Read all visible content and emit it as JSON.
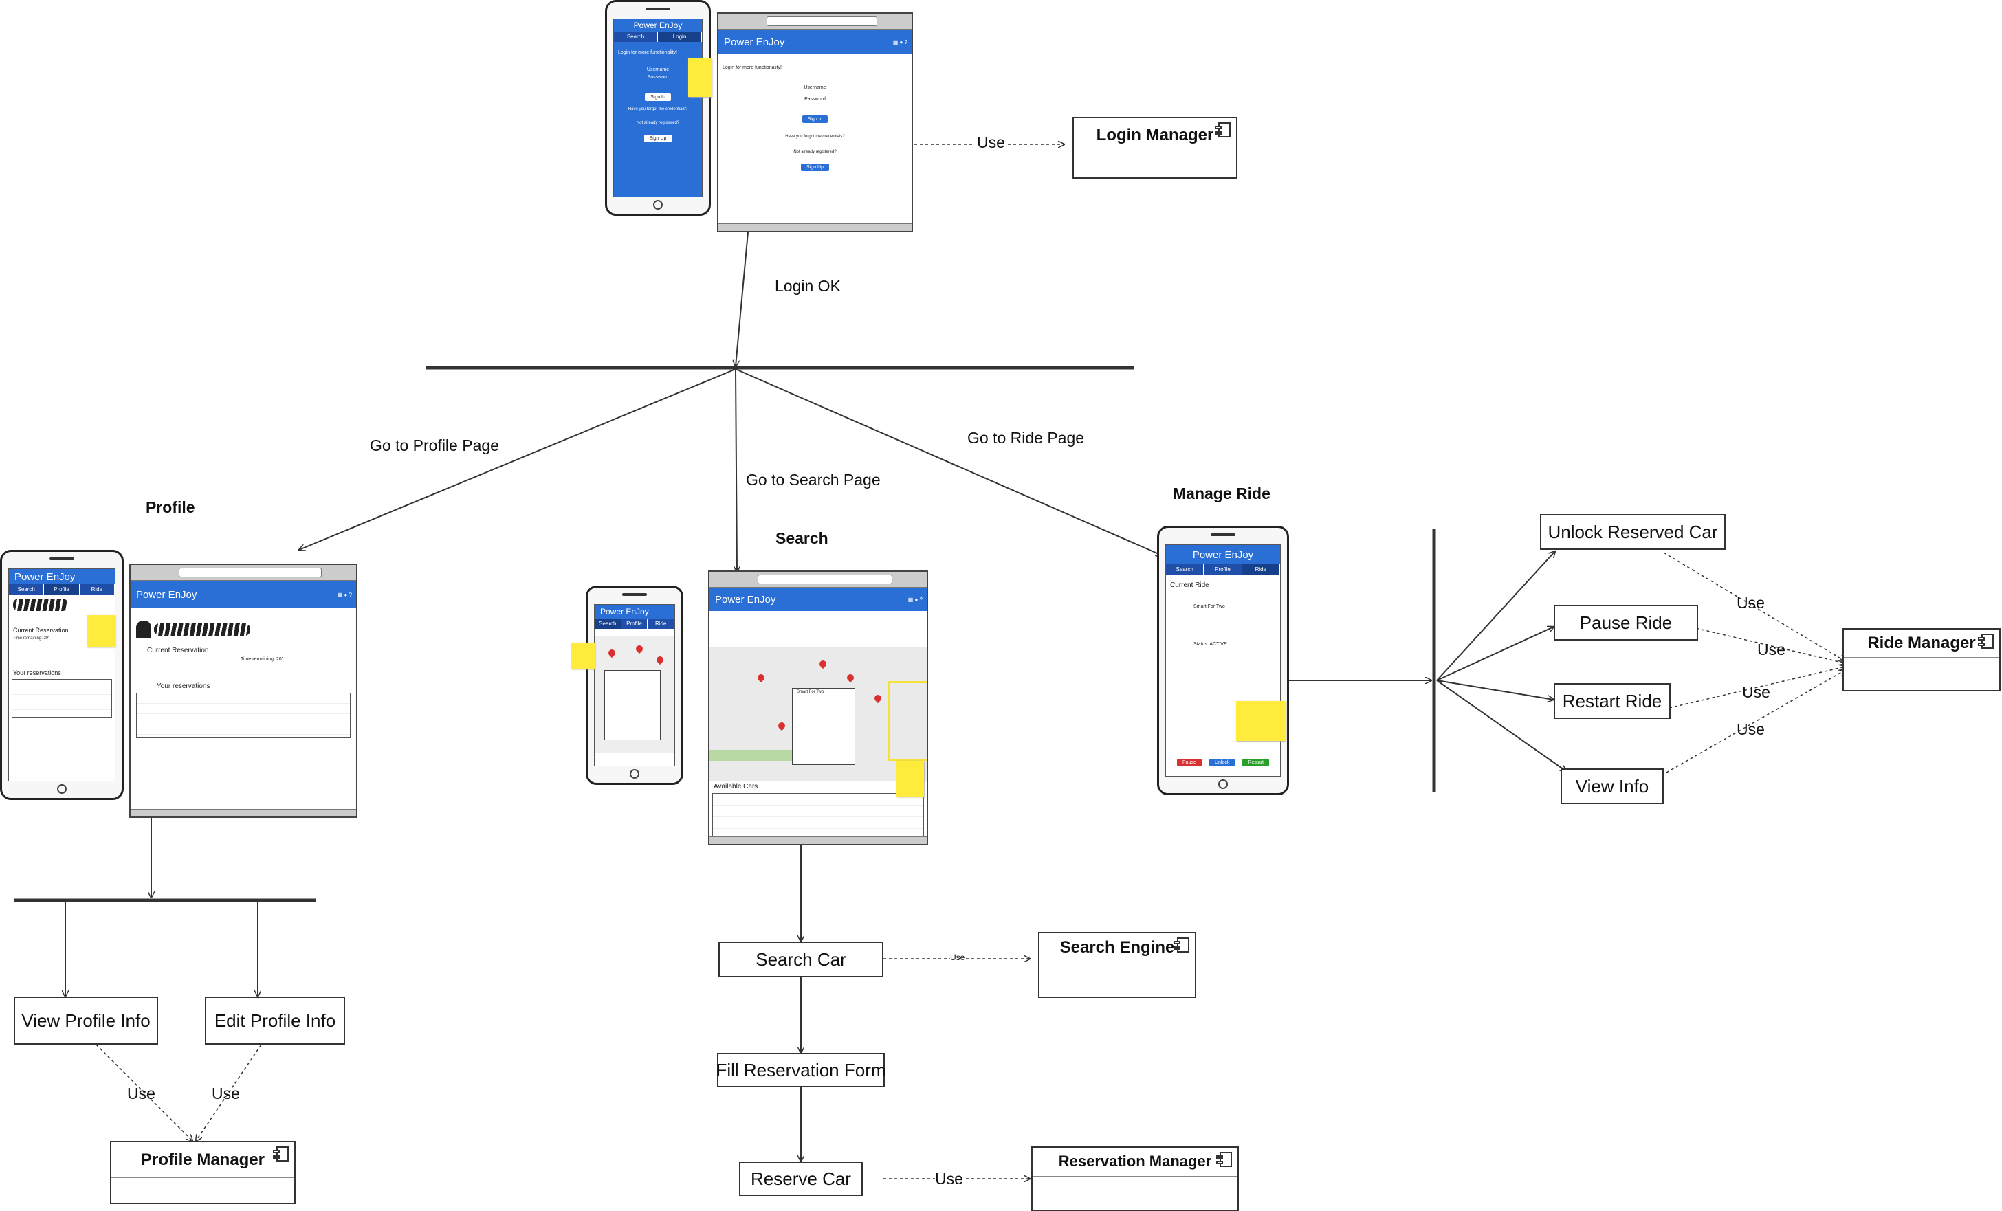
{
  "labels": {
    "login_use": "Use",
    "login_ok": "Login OK",
    "go_profile": "Go to Profile Page",
    "go_search": "Go to Search Page",
    "go_ride": "Go to Ride Page",
    "use_view_profile": "Use",
    "use_edit_profile": "Use",
    "use_search_engine": "Use",
    "use_reservation": "Use",
    "use_unlock": "Use",
    "use_pause": "Use",
    "use_restart": "Use",
    "use_view_info": "Use"
  },
  "titles": {
    "profile": "Profile",
    "search": "Search",
    "manage_ride": "Manage Ride"
  },
  "actions": {
    "view_profile_info": "View Profile Info",
    "edit_profile_info": "Edit Profile Info",
    "search_car": "Search Car",
    "fill_reservation_form": "Fill Reservation Form",
    "reserve_car": "Reserve Car",
    "unlock_reserved_car": "Unlock Reserved Car",
    "pause_ride": "Pause Ride",
    "restart_ride": "Restart Ride",
    "view_info": "View Info"
  },
  "components": {
    "login_manager": "Login Manager",
    "profile_manager": "Profile Manager",
    "search_engine": "Search Engine",
    "reservation_manager": "Reservation Manager",
    "ride_manager": "Ride Manager"
  },
  "mockups": {
    "app_name": "Power EnJoy",
    "tab_search": "Search",
    "tab_profile": "Profile",
    "tab_ride": "Ride",
    "tab_login": "Login",
    "nav_map": "Map",
    "nav_profile": "Profile",
    "nav_help": "Help",
    "login_prompt": "Login for more functionality!",
    "username": "Username",
    "password": "Password",
    "sign_in": "Sign In",
    "forgot": "Have you forgot the credentials?",
    "not_registered": "Not already registered?",
    "sign_up": "Sign Up",
    "current_reservation": "Current Reservation",
    "your_reservations": "Your reservations",
    "current_ride": "Current Ride",
    "available_cars": "Available Cars",
    "btn_pause": "Pause",
    "btn_unlock": "Unlock",
    "btn_restart": "Restart",
    "status_active": "Status: ACTIVE",
    "time_remaining": "Time remaining: 20'",
    "car_name": "Smart For Two",
    "reserve": "Reserve"
  },
  "colors": {
    "app_blue": "#2a6fd6",
    "sticky_yellow": "#ffeb3b"
  }
}
